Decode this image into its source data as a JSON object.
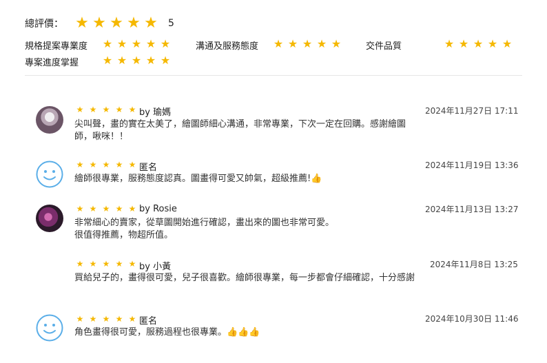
{
  "summary": {
    "overall_label": "總評價：",
    "overall_score": "5",
    "overall_rating": 5,
    "criteria": [
      {
        "label": "規格提案專業度",
        "rating": 5
      },
      {
        "label": "溝通及服務態度",
        "rating": 5
      },
      {
        "label": "交件品質",
        "rating": 5
      },
      {
        "label": "專案進度掌握",
        "rating": 5
      }
    ]
  },
  "colors": {
    "star": "#f5b800",
    "divider": "#e6e6e6",
    "smile_icon": "#5aaee8"
  },
  "reviews": [
    {
      "author": "by 瑜媽",
      "avatar": "user-photo",
      "rating": 5,
      "date": "2024年11月27日 17:11",
      "text": "尖叫聲，畫的實在太美了，繪圖師細心溝通，非常專業，下次一定在回購。感謝繪圖師，啾咪！！"
    },
    {
      "author": "匿名",
      "avatar": "smiley-icon",
      "rating": 5,
      "date": "2024年11月19日 13:36",
      "text": "繪師很專業，服務態度認真。圖畫得可愛又帥氣，超級推薦!👍"
    },
    {
      "author": "by Rosie",
      "avatar": "user-photo",
      "rating": 5,
      "date": "2024年11月13日 13:27",
      "text": "非常細心的賣家，從草圖開始進行確認，畫出來的圖也非常可愛。\n很值得推薦，物超所值。"
    },
    {
      "author": "by 小黃",
      "avatar": "none",
      "rating": 5,
      "date": "2024年11月8日 13:25",
      "text": "買給兒子的，畫得很可愛，兒子很喜歡。繪師很專業，每一步都會仔細確認，十分感謝"
    },
    {
      "author": "匿名",
      "avatar": "smiley-icon",
      "rating": 5,
      "date": "2024年10月30日 11:46",
      "text": "角色畫得很可愛，服務過程也很專業。👍👍👍"
    }
  ]
}
